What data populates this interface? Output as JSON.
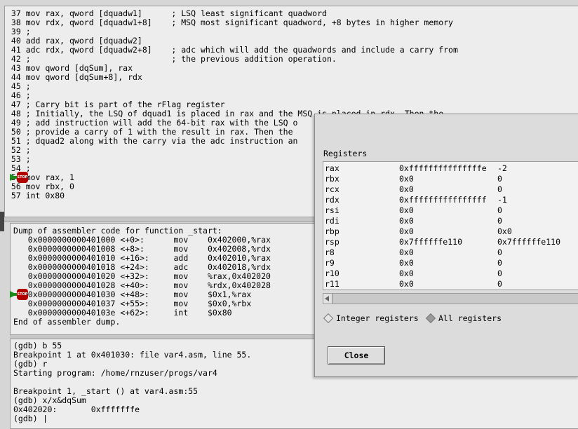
{
  "source": {
    "lines": [
      " 37 mov rax, qword [dquadw1]      ; LSQ least significant quadword",
      " 38 mov rdx, qword [dquadw1+8]    ; MSQ most significant quadword, +8 bytes in higher memory",
      " 39 ;",
      " 40 add rax, qword [dquadw2]",
      " 41 adc rdx, qword [dquadw2+8]    ; adc which will add the quadwords and include a carry from",
      " 42 ;                             ; the previous addition operation.",
      " 43 mov qword [dqSum], rax",
      " 44 mov qword [dqSum+8], rdx",
      " 45 ;",
      " 46 ;",
      " 47 ; Carry bit is part of the rFlag register",
      " 48 ; Initially, the LSQ of dquad1 is placed in rax and the MSQ is placed in rdx. Then the",
      " 49 ; add instruction will add the 64-bit rax with the LSQ o",
      " 50 ; provide a carry of 1 with the result in rax. Then the ",
      " 51 ; dquad2 along with the carry via the adc instruction an",
      " 52 ;",
      " 53 ;",
      " 54 ;",
      " 55 mov rax, 1",
      " 56 mov rbx, 0",
      " 57 int 0x80"
    ],
    "breakpoint_line_label": "STOP"
  },
  "assembler": {
    "lines": [
      "Dump of assembler code for function _start:",
      "   0x0000000000401000 <+0>:      mov    0x402000,%rax",
      "   0x0000000000401008 <+8>:      mov    0x402008,%rdx",
      "   0x0000000000401010 <+16>:     add    0x402010,%rax",
      "   0x0000000000401018 <+24>:     adc    0x402018,%rdx",
      "   0x0000000000401020 <+32>:     mov    %rax,0x402020",
      "   0x0000000000401028 <+40>:     mov    %rdx,0x402028",
      "   0x0000000000401030 <+48>:     mov    $0x1,%rax",
      "   0x0000000000401037 <+55>:     mov    $0x0,%rbx",
      "   0x000000000040103e <+62>:     int    $0x80",
      "End of assembler dump."
    ],
    "breakpoint_label": "STOP"
  },
  "console": {
    "lines": [
      "(gdb) b 55",
      "Breakpoint 1 at 0x401030: file var4.asm, line 55.",
      "(gdb) r",
      "Starting program: /home/rnzuser/progs/var4",
      "",
      "Breakpoint 1, _start () at var4.asm:55",
      "(gdb) x/x&dqSum",
      "0x402020:       0xfffffffe",
      "(gdb) "
    ]
  },
  "registers_dialog": {
    "title": "Registers",
    "rows": [
      {
        "name": "rax",
        "hex": "0xfffffffffffffffe",
        "natural": "-2"
      },
      {
        "name": "rbx",
        "hex": "0x0",
        "natural": "0"
      },
      {
        "name": "rcx",
        "hex": "0x0",
        "natural": "0"
      },
      {
        "name": "rdx",
        "hex": "0xffffffffffffffff",
        "natural": "-1"
      },
      {
        "name": "rsi",
        "hex": "0x0",
        "natural": "0"
      },
      {
        "name": "rdi",
        "hex": "0x0",
        "natural": "0"
      },
      {
        "name": "rbp",
        "hex": "0x0",
        "natural": "0x0"
      },
      {
        "name": "rsp",
        "hex": "0x7ffffffe110",
        "natural": "0x7ffffffe110"
      },
      {
        "name": "r8",
        "hex": "0x0",
        "natural": "0"
      },
      {
        "name": "r9",
        "hex": "0x0",
        "natural": "0"
      },
      {
        "name": "r10",
        "hex": "0x0",
        "natural": "0"
      },
      {
        "name": "r11",
        "hex": "0x0",
        "natural": "0"
      }
    ],
    "radio_integer_label": "Integer registers",
    "radio_all_label": "All registers",
    "selected_radio": "all",
    "close_label": "Close"
  }
}
